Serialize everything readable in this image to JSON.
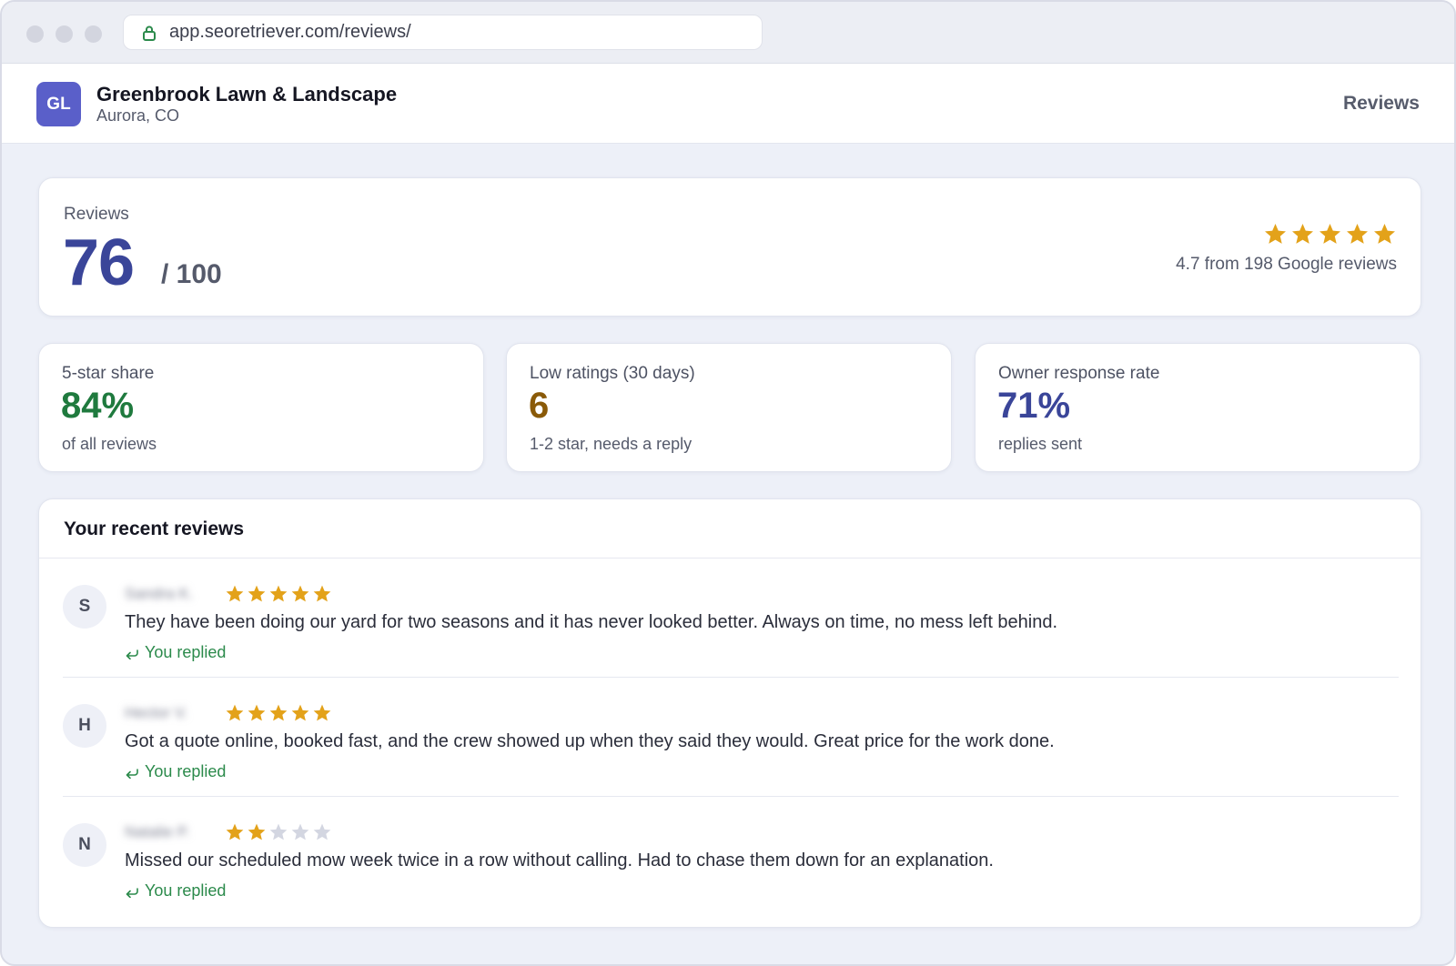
{
  "browser": {
    "url": "app.seoretriever.com/reviews/"
  },
  "header": {
    "avatar_initials": "GL",
    "business_name": "Greenbrook Lawn & Landscape",
    "location": "Aurora, CO",
    "nav_label": "Reviews",
    "avatar_color": "#5a5fc9"
  },
  "score": {
    "label": "Reviews",
    "value": "76",
    "max": "/ 100",
    "stars": 5,
    "rating_text": "4.7 from 198 Google reviews",
    "accent_color": "#3a4599",
    "star_color": "#e3a21a"
  },
  "stats": [
    {
      "label": "5-star share",
      "value": "84%",
      "sub": "of all reviews",
      "color": "#1f7a3e"
    },
    {
      "label": "Low ratings (30 days)",
      "value": "6",
      "sub": "1-2 star, needs a reply",
      "color": "#8a5a08"
    },
    {
      "label": "Owner response rate",
      "value": "71%",
      "sub": "replies sent",
      "color": "#3a4599"
    }
  ],
  "recent_reviews": {
    "title": "Your recent reviews",
    "items": [
      {
        "initial": "S",
        "name": "Sandra K.",
        "stars": 5,
        "text": "They have been doing our yard for two seasons and it has never looked better. Always on time, no mess left behind.",
        "reply": "You replied"
      },
      {
        "initial": "H",
        "name": "Hector V.",
        "stars": 5,
        "text": "Got a quote online, booked fast, and the crew showed up when they said they would. Great price for the work done.",
        "reply": "You replied"
      },
      {
        "initial": "N",
        "name": "Natalie P.",
        "stars": 2,
        "text": "Missed our scheduled mow week twice in a row without calling. Had to chase them down for an explanation.",
        "reply": "You replied"
      }
    ]
  },
  "icons": {
    "lock": "lock-icon",
    "star": "star-icon",
    "reply": "reply-arrow-icon"
  }
}
